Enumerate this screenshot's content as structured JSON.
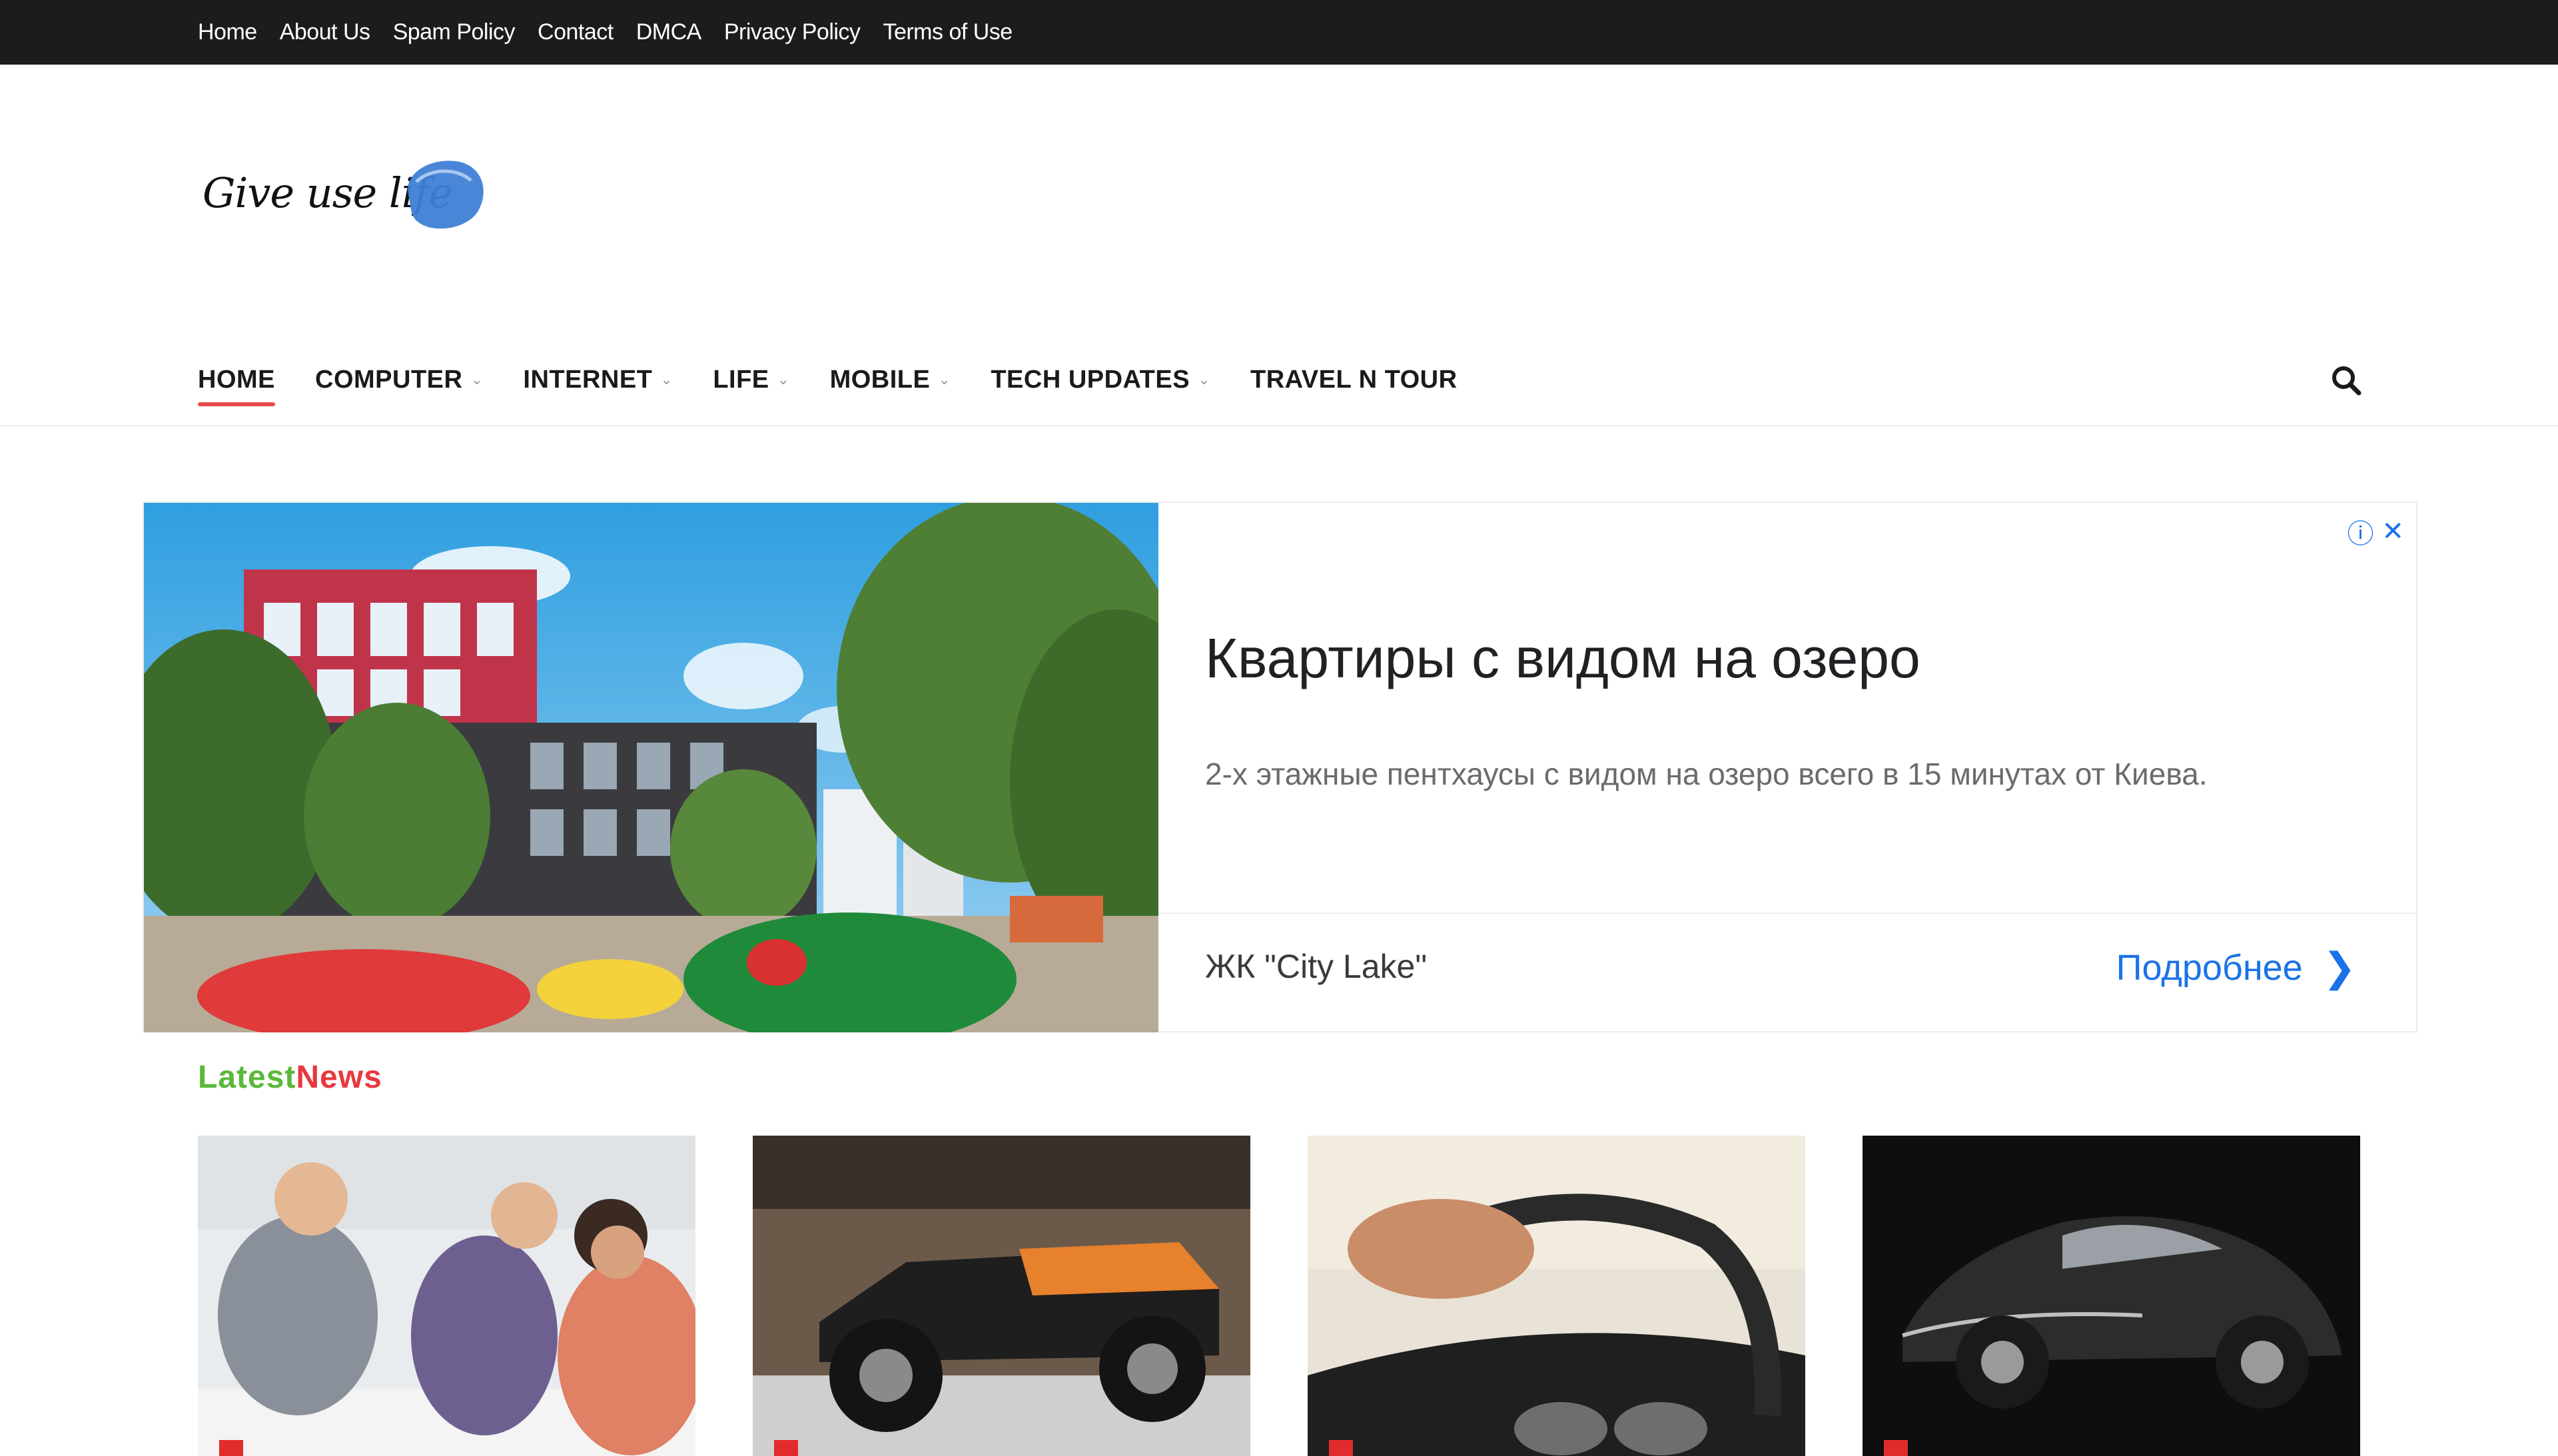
{
  "topbar": {
    "links": [
      "Home",
      "About Us",
      "Spam Policy",
      "Contact",
      "DMCA",
      "Privacy Policy",
      "Terms of Use"
    ]
  },
  "logo": {
    "text": "Give use life"
  },
  "nav": {
    "items": [
      {
        "label": "HOME",
        "dropdown": false,
        "active": true
      },
      {
        "label": "COMPUTER",
        "dropdown": true
      },
      {
        "label": "INTERNET",
        "dropdown": true
      },
      {
        "label": "LIFE",
        "dropdown": true
      },
      {
        "label": "MOBILE",
        "dropdown": true
      },
      {
        "label": "TECH UPDATES",
        "dropdown": true
      },
      {
        "label": "TRAVEL N TOUR",
        "dropdown": false
      }
    ],
    "dropdown_glyph": "⌄",
    "search_icon": "search-icon"
  },
  "ad": {
    "title": "Квартиры с видом на озеро",
    "description": "2-х этажные пентхаусы с видом на озеро всего в 15 минутах от Киева.",
    "advertiser": "ЖК \"City Lake\"",
    "cta": "Подробнее",
    "cta_arrow": "❯",
    "info_glyph": "ⓘ",
    "close_glyph": "✕"
  },
  "latest_news": {
    "heading_part1": "Latest",
    "heading_part2": "News"
  },
  "colors": {
    "accent_red": "#e84a4a",
    "latest_green": "#5bb83a",
    "latest_red": "#e8383f",
    "ad_blue": "#1a73e8",
    "topbar": "#1c1c1c"
  }
}
